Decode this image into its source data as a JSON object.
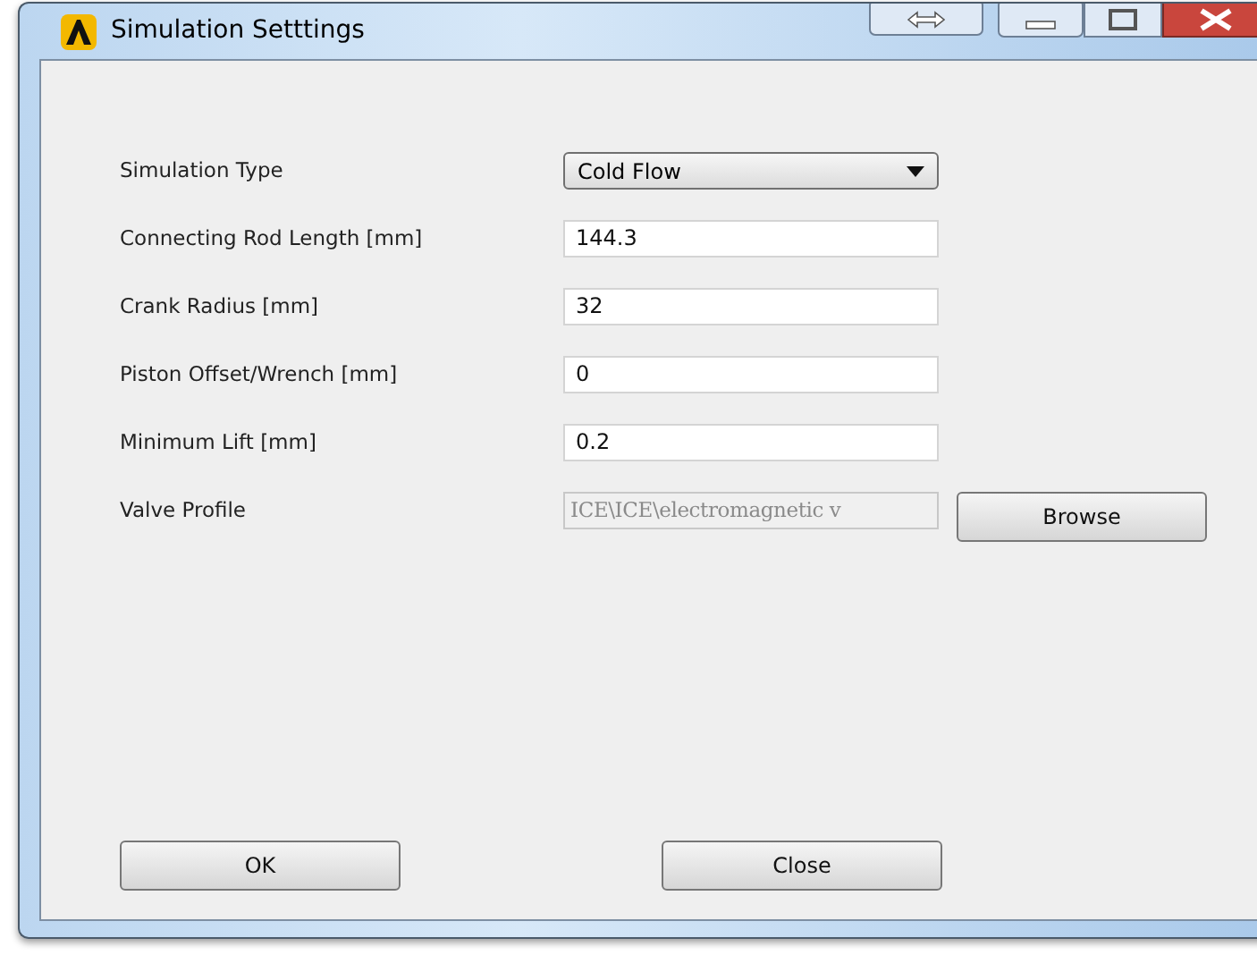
{
  "window": {
    "title": "Simulation Setttings"
  },
  "fields": [
    {
      "label": "Simulation Type",
      "kind": "dropdown",
      "value": "Cold Flow",
      "disabled": false
    },
    {
      "label": "Connecting Rod Length [mm]",
      "kind": "text",
      "value": "144.3",
      "disabled": false
    },
    {
      "label": "Crank Radius [mm]",
      "kind": "text",
      "value": "32",
      "disabled": false
    },
    {
      "label": "Piston Offset/Wrench [mm]",
      "kind": "text",
      "value": "0",
      "disabled": false
    },
    {
      "label": "Minimum Lift [mm]",
      "kind": "text",
      "value": "0.2",
      "disabled": false
    },
    {
      "label": "Valve Profile",
      "kind": "file",
      "value": "ICE\\ICE\\electromagnetic v",
      "disabled": true,
      "button": "Browse"
    }
  ],
  "buttons": [
    "OK",
    "Close"
  ]
}
